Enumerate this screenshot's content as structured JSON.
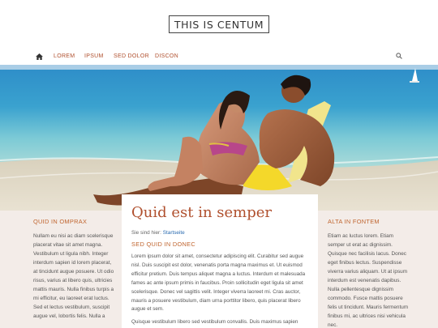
{
  "header": {
    "logo": "THIS IS CENTUM"
  },
  "nav": {
    "home_icon": "home-icon",
    "items": [
      "LOREM",
      "IPSUM",
      "SED DOLOR",
      "DISCON"
    ],
    "search_icon": "search-icon"
  },
  "left_column": {
    "title": "QUID IN OMPRAX",
    "text": "Nullam eu nisi ac diam scelerisque placerat vitae sit amet magna. Vestibulum ut ligula nibh. Integer interdum sapien id lorem placerat, at tincidunt augue posuere. Ut odio risus, varius at libero quis, ultricies mattis mauris. Nulla finibus turpis a mi efficitur, eu laoreet erat luctus. Sed et lectus vestibulum, suscipit augue vel, lobortis felis. Nulla a"
  },
  "main": {
    "title": "Quid est in semper",
    "breadcrumb_prefix": "Sie sind hier:",
    "breadcrumb_link": "Startseite",
    "subtitle": "SED QUID IN DONEC",
    "paragraph1": "Lorem ipsum dolor sit amet, consectetur adipiscing elit. Curabitur sed augue nisl. Duis suscipit est dolor, venenatis porta magna maximus et. Ut euismod efficitur pretium. Duis tempus aliquet magna a luctus. Interdum et malesuada fames ac ante ipsum primis in faucibus. Proin sollicitudin eget ligula sit amet scelerisque. Donec vel sagittis velit. Integer viverra laoreet mi. Cras auctor, mauris a posuere vestibulum, diam urna porttitor libero, quis placerat libero augue et sem.",
    "paragraph2": "Quisque vestibulum libero sed vestibulum convallis. Duis maximus sapien"
  },
  "right_column": {
    "title": "ALTA IN FONTEM",
    "text": "Etiam ac luctus lorem. Etiam semper ut erat ac dignissim. Quisque nec facilisis lacus. Donec eget finibus lectus. Suspendisse viverra varius aliquam. Ut at ipsum interdum est venenatis dapibus. Nulla pellentesque dignissim commodo. Fusce mattis posuere felis ut tincidunt. Mauris fermentum finibus mi, ac ultrices nisi vehicula nec."
  },
  "colors": {
    "accent": "#b0502e",
    "subhead": "#c0652f",
    "link": "#2a6bb0",
    "side_bg": "#f3ece8"
  }
}
